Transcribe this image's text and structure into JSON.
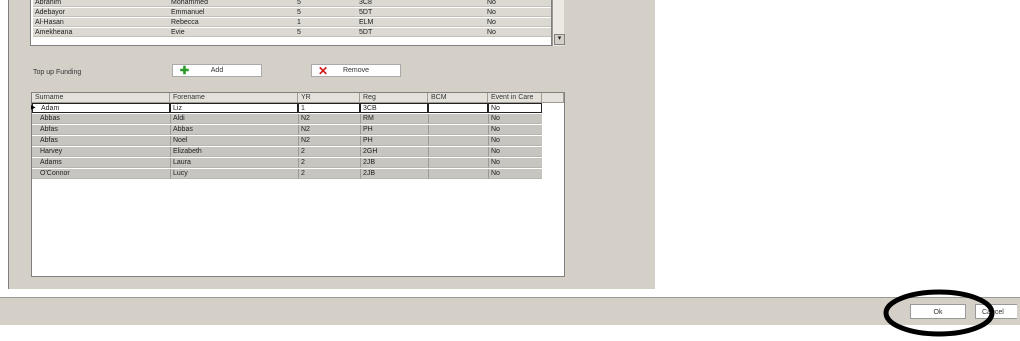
{
  "top_table": {
    "rows": [
      [
        "Abrahim",
        "Mohammed",
        "5",
        "3C8",
        "",
        "No"
      ],
      [
        "Adebayor",
        "Emmanuel",
        "5",
        "5DT",
        "",
        "No"
      ],
      [
        "Al-Hasan",
        "Rebecca",
        "1",
        "ELM",
        "",
        "No"
      ],
      [
        "Amekheana",
        "Evie",
        "5",
        "5DT",
        "",
        "No"
      ]
    ]
  },
  "section": {
    "label": "Top up Funding",
    "add_label": "Add",
    "remove_label": "Remove"
  },
  "bottom_table": {
    "headers": [
      "Surname",
      "Forename",
      "YR",
      "Reg",
      "BCM",
      "Event in Care"
    ],
    "rows": [
      [
        "Adam",
        "Liz",
        "1",
        "3CB",
        "",
        "No"
      ],
      [
        "Abbas",
        "Aldi",
        "N2",
        "RM",
        "",
        "No"
      ],
      [
        "Abfas",
        "Abbas",
        "N2",
        "PH",
        "",
        "No"
      ],
      [
        "Abfas",
        "Noel",
        "N2",
        "PH",
        "",
        "No"
      ],
      [
        "Harvey",
        "Elizabeth",
        "2",
        "2GH",
        "",
        "No"
      ],
      [
        "Adams",
        "Laura",
        "2",
        "2JB",
        "",
        "No"
      ],
      [
        "O'Connor",
        "Lucy",
        "2",
        "2JB",
        "",
        "No"
      ]
    ],
    "selected_index": 0,
    "row_pointer": "▶"
  },
  "footer": {
    "ok_label": "Ok",
    "cancel_label": "Cancel"
  },
  "icons": {
    "add": "plus-icon",
    "remove": "x-icon"
  },
  "colors": {
    "panel": "#d4d0c8",
    "add_icon": "#2a9a2a",
    "remove_icon": "#d21a1a",
    "annotation_circle": "#000000"
  }
}
